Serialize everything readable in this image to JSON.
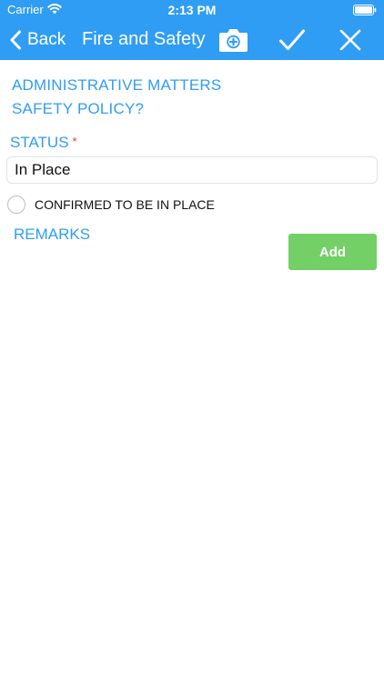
{
  "status_bar": {
    "carrier": "Carrier",
    "time": "2:13 PM"
  },
  "nav": {
    "back_label": "Back",
    "title": "Fire and Safety",
    "icons": {
      "back": "chevron-left-icon",
      "camera": "camera-icon",
      "confirm": "checkmark-icon",
      "close": "close-icon"
    }
  },
  "form": {
    "section": "ADMINISTRATIVE MATTERS",
    "question": "SAFETY POLICY?",
    "status_label": "STATUS",
    "required_mark": "*",
    "status_value": "In Place",
    "confirm_option": {
      "label": "CONFIRMED TO BE IN PLACE",
      "selected": false
    },
    "remarks_label": "REMARKS",
    "add_label": "Add"
  },
  "colors": {
    "accent": "#2f9df3",
    "add_button": "#72d066",
    "required": "#e53935",
    "text": "#111111",
    "background": "#ffffff"
  }
}
